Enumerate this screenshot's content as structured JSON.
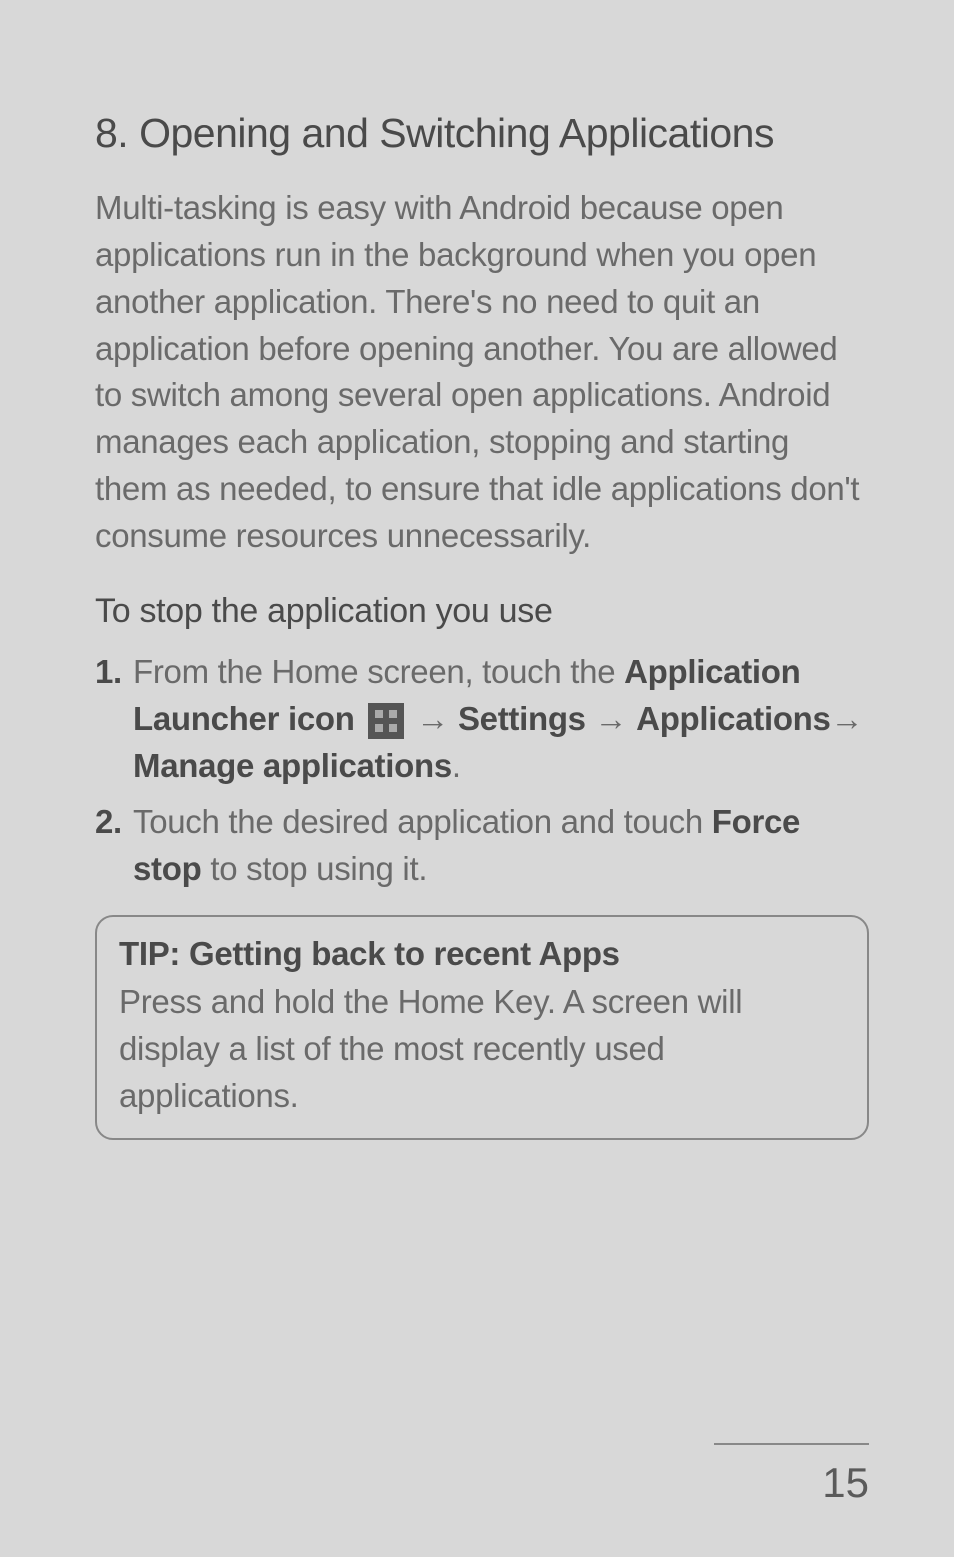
{
  "section": {
    "heading": "8. Opening and Switching Applications",
    "body": "Multi-tasking is easy with Android because open applications run in the background when you open another application. There's no need to quit an application before opening another. You are allowed to switch among several open applications. Android manages each application, stopping and starting them as needed, to ensure that idle applications don't consume resources unnecessarily."
  },
  "subsection": {
    "heading": "To stop the application you use",
    "steps": [
      {
        "number": "1.",
        "text_prefix": "From the Home screen, touch the ",
        "bold1": "Application Launcher icon",
        "arrow1": " → ",
        "bold2": "Settings",
        "arrow2": " → ",
        "bold3": "Applications",
        "arrow3": "→ ",
        "bold4": "Manage applications",
        "text_suffix": "."
      },
      {
        "number": "2.",
        "text_prefix": "Touch the desired application and touch ",
        "bold1": "Force stop",
        "text_suffix": " to stop using it."
      }
    ]
  },
  "tip": {
    "title": "TIP: Getting back to recent Apps",
    "body": "Press and hold the Home Key. A screen will display a list of the most recently used applications."
  },
  "page_number": "15"
}
